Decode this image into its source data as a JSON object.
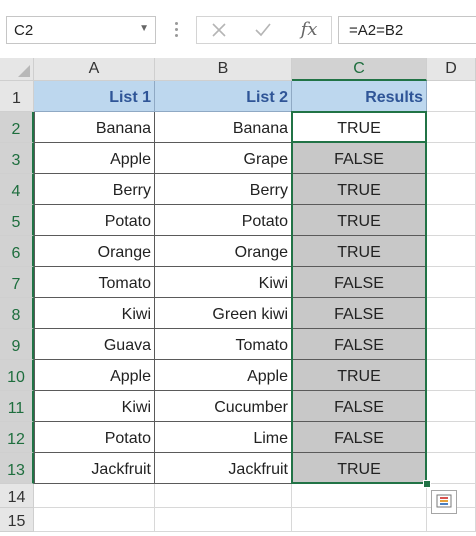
{
  "name_box": {
    "value": "C2",
    "dropdown_icon": "chevron-down-icon"
  },
  "formula_bar": {
    "cancel_icon": "close-icon",
    "enter_icon": "check-icon",
    "function_label": "fx",
    "formula": "=A2=B2"
  },
  "columns": [
    "A",
    "B",
    "C",
    "D"
  ],
  "selected_column": "C",
  "rows": [
    "1",
    "2",
    "3",
    "4",
    "5",
    "6",
    "7",
    "8",
    "9",
    "10",
    "11",
    "12",
    "13",
    "14",
    "15"
  ],
  "table": {
    "headers": [
      "List 1",
      "List 2",
      "Results"
    ],
    "rows": [
      [
        "Banana",
        "Banana",
        "TRUE"
      ],
      [
        "Apple",
        "Grape",
        "FALSE"
      ],
      [
        "Berry",
        "Berry",
        "TRUE"
      ],
      [
        "Potato",
        "Potato",
        "TRUE"
      ],
      [
        "Orange",
        "Orange",
        "TRUE"
      ],
      [
        "Tomato",
        "Kiwi",
        "FALSE"
      ],
      [
        "Kiwi",
        "Green kiwi",
        "FALSE"
      ],
      [
        "Guava",
        "Tomato",
        "FALSE"
      ],
      [
        "Apple",
        "Apple",
        "TRUE"
      ],
      [
        "Kiwi",
        "Cucumber",
        "FALSE"
      ],
      [
        "Potato",
        "Lime",
        "FALSE"
      ],
      [
        "Jackfruit",
        "Jackfruit",
        "TRUE"
      ]
    ]
  },
  "active_cell": "C2",
  "quick_analysis_icon": "quick-analysis-icon",
  "colors": {
    "header_fill": "#bdd7ee",
    "header_text": "#2f5597",
    "shaded_fill": "#c8c8c8",
    "selection": "#217346"
  }
}
